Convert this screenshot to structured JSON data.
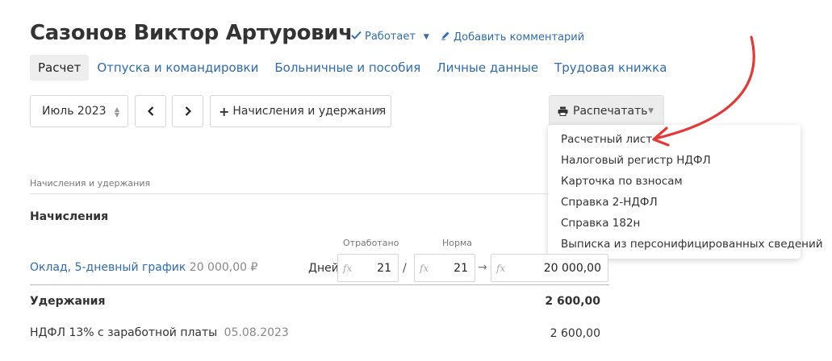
{
  "header": {
    "name": "Сазонов Виктор Артурович",
    "status": "Работает",
    "add_comment": "Добавить комментарий"
  },
  "tabs": [
    {
      "label": "Расчет",
      "active": true
    },
    {
      "label": "Отпуска и командировки"
    },
    {
      "label": "Больничные и пособия"
    },
    {
      "label": "Личные данные"
    },
    {
      "label": "Трудовая книжка"
    }
  ],
  "toolbar": {
    "month": "Июль 2023",
    "prev": "‹",
    "next": "›",
    "accruals_button": "Начисления и удержания",
    "print_button": "Распечатать"
  },
  "print_menu": [
    "Расчетный лист",
    "Налоговый регистр НДФЛ",
    "Карточка по взносам",
    "Справка 2-НДФЛ",
    "Справка 182н",
    "Выписка из персонифицированных сведений"
  ],
  "table": {
    "section_label": "Начисления и удержания",
    "accruals_heading": "Начисления",
    "col_worked": "Отработано",
    "col_norm": "Норма",
    "row": {
      "name": "Оклад, 5-дневный график",
      "amount_hint": "20 000,00 ₽",
      "days_label": "Дней",
      "fx": "fx",
      "worked": "21",
      "norm": "21",
      "total": "20 000,00",
      "slash": "/"
    },
    "deductions_heading": "Удержания",
    "deductions_total": "2 600,00",
    "ndfl": {
      "label": "НДФЛ 13% с заработной платы",
      "date": "05.08.2023",
      "amount": "2 600,00"
    }
  },
  "colors": {
    "link": "#2f6bb0",
    "annotation_arrow": "#e53935"
  }
}
